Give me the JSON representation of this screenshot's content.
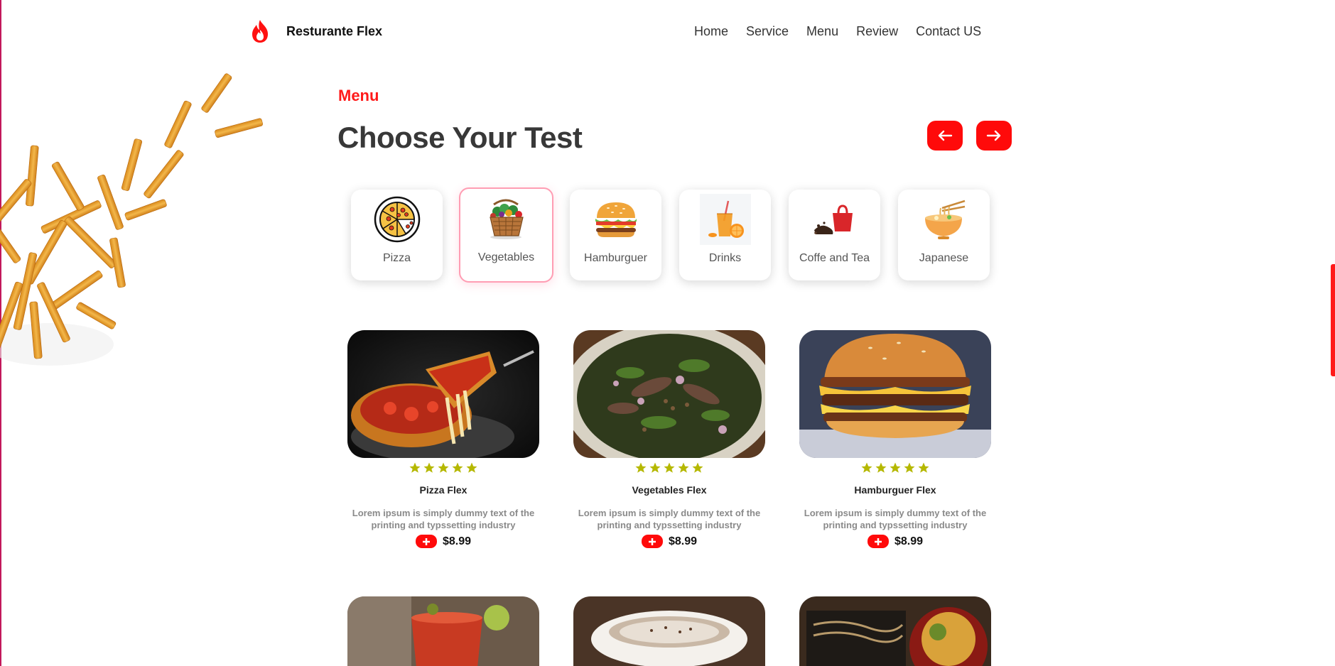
{
  "header": {
    "brand": "Resturante Flex",
    "nav": [
      "Home",
      "Service",
      "Menu",
      "Review",
      "Contact US"
    ]
  },
  "section": {
    "eyebrow": "Menu",
    "title": "Choose Your Test"
  },
  "categories": [
    {
      "label": "Pizza",
      "icon": "pizza-icon"
    },
    {
      "label": "Vegetables",
      "icon": "vegetable-basket-icon",
      "active": true
    },
    {
      "label": "Hamburguer",
      "icon": "hamburger-icon"
    },
    {
      "label": "Drinks",
      "icon": "drink-icon"
    },
    {
      "label": "Coffe and Tea",
      "icon": "coffee-tea-icon"
    },
    {
      "label": "Japanese",
      "icon": "ramen-icon"
    }
  ],
  "products": [
    {
      "name": "Pizza Flex",
      "rating": 5,
      "description": "Lorem ipsum is simply dummy text of the printing and typssetting industry",
      "price": "$8.99"
    },
    {
      "name": "Vegetables Flex",
      "rating": 5,
      "description": "Lorem ipsum is simply dummy text of the printing and typssetting industry",
      "price": "$8.99"
    },
    {
      "name": "Hamburguer Flex",
      "rating": 5,
      "description": "Lorem ipsum is simply dummy text of the printing and typssetting industry",
      "price": "$8.99"
    }
  ],
  "colors": {
    "accent": "#ff0a0a",
    "star": "#b5b800",
    "title": "#383838"
  }
}
